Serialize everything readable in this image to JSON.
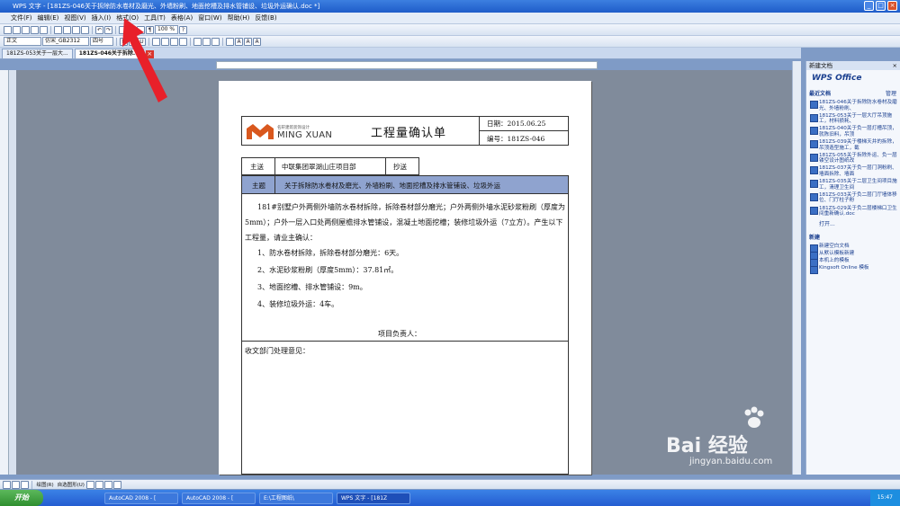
{
  "window": {
    "title": "WPS 文字 - [181ZS-046关于拆除防水卷材及磨光、外墙粉刷、地面挖槽及排水管铺设、垃圾外运确认.doc *]"
  },
  "menubar": {
    "items": [
      "文件(F)",
      "编辑(E)",
      "视图(V)",
      "插入(I)",
      "格式(O)",
      "工具(T)",
      "表格(A)",
      "窗口(W)",
      "帮助(H)",
      "反馈(B)"
    ]
  },
  "toolbar": {
    "zoom": "100 %",
    "style": "正文",
    "font": "仿宋_GB2312",
    "size": "四号"
  },
  "tabs": [
    {
      "label": "181ZS-053关于一层大..."
    },
    {
      "label": "181ZS-046关于拆除..."
    }
  ],
  "document": {
    "logo_top": "名轩建筑装饰设计",
    "logo_main": "MING XUAN",
    "title": "工程量确认单",
    "date_label": "日期：2015.06.25",
    "number_label": "编号：181ZS-046",
    "to_label": "主送",
    "to_value": "中联集团翠湖山庄项目部",
    "cc_label": "抄送",
    "subject_label": "主题",
    "subject_value": "关于拆除防水卷材及磨光、外墙粉刷、地面挖槽及排水管铺设、垃圾外运",
    "body": "181#别墅户外两侧外墙防水卷材拆除，拆除卷材部分磨光；户外两侧外墙水泥砂浆粉刷（厚度为5mm）；户外一层入口处两侧屋檐排水管铺设，混凝土地面挖槽；装修垃圾外运（7立方）。产生以下工程量，请业主确认：",
    "items": [
      "1、防水卷材拆除，拆除卷材部分磨光：6天。",
      "2、水泥砂浆粉刷（厚度5mm）：37.81㎡。",
      "3、地面挖槽、排水管铺设：9m。",
      "4、装修垃圾外运：4车。"
    ],
    "pm_label": "项目负责人：",
    "opinion_label": "收文部门处理意见："
  },
  "taskpane": {
    "header": "新建文档",
    "brand": "WPS Office",
    "recent_label": "最近文档",
    "manage": "管理",
    "recent": [
      "181ZS-046关于拆除防水卷材及磨光、外墙粉刷、",
      "181ZS-053关于一层大厅吊顶施工，材料损耗、",
      "181ZS-040关于负一层灯槽吊顶，就陈旧料，吊顶",
      "181ZS-039关于楼梯天井的拆除，吊顶造型施工，截",
      "181ZS-055关于拆除外运、负一层镂空设计图纸改",
      "181ZS-037关于负一层门洞粉刷、墙面拆除、墙面",
      "181ZS-035关于二层卫生间项目施工，清理卫生间",
      "181ZS-033关于负二层门厅墙体移位、门厅柱子粉",
      "181ZS-029关于负二层楼梯口卫生间重新确认.doc"
    ],
    "open": "打开...",
    "new_label": "新建",
    "new_items": [
      "新建空白文档",
      "从默认模板新建",
      "本机上的模板",
      "Kingsoft Online 模板"
    ]
  },
  "taskbar": {
    "start": "开始",
    "tasks": [
      "AutoCAD 2008 - [",
      "AutoCAD 2008 - [",
      "E:\\工程图纸\\",
      "WPS 文字 - [181Z"
    ],
    "clock": "15:47"
  },
  "bottombar": {
    "draw_label": "绘图(R)",
    "autoshape_label": "自选图形(U)"
  },
  "watermark": {
    "brand": "Bai 经验",
    "url": "jingyan.baidu.com"
  },
  "colors": {
    "subject_row": "#8fa3cf",
    "arrow": "#e8202a",
    "taskbar": "#245dd1"
  }
}
